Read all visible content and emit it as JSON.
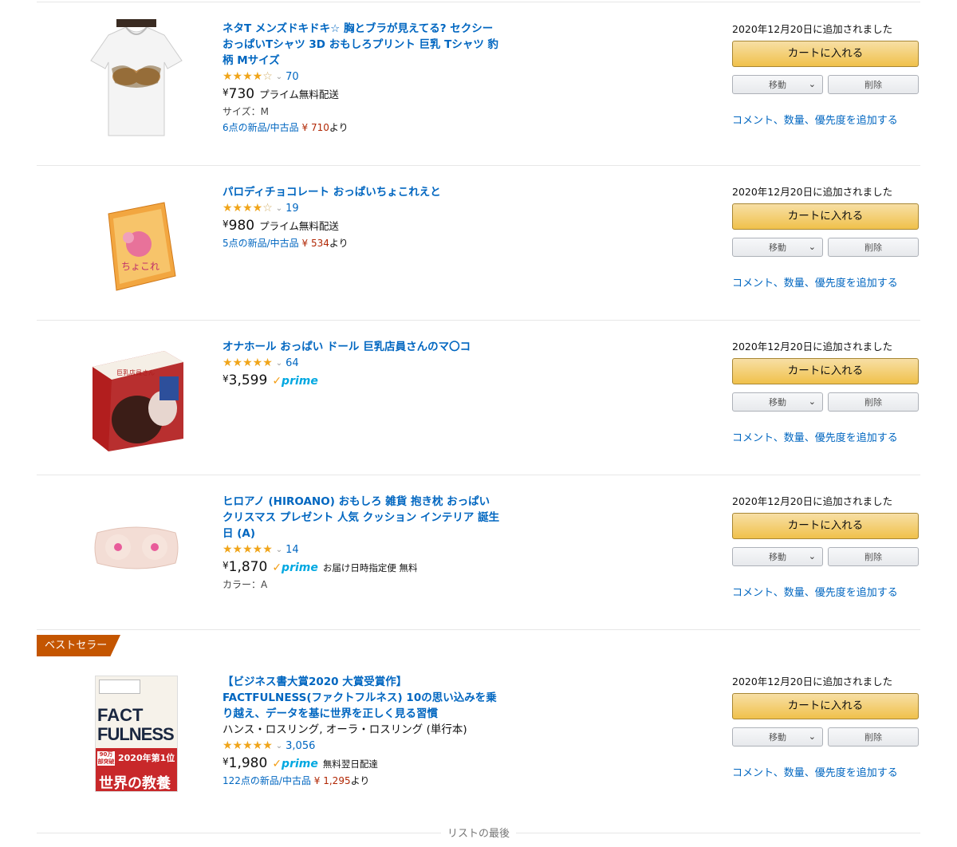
{
  "colors": {
    "link": "#0066c0",
    "price_red": "#b12704",
    "cart_button": "#f0c14b",
    "badge": "#c45500",
    "prime": "#00a8e1",
    "star": "#f0a51a"
  },
  "items": [
    {
      "title": "ネタT メンズドキドキ☆ 胸とブラが見えてる? セクシーおっぱいTシャツ 3D おもしろプリント 巨乳 Tシャツ 豹柄 Mサイズ",
      "rating": 3.5,
      "stars": "★★★★",
      "stars_empty": "☆",
      "review_count": "70",
      "price": "730",
      "currency": "¥",
      "shipping": "プライム無料配送",
      "variant": "サイズ：M",
      "offers_text": "6点の新品/中古品",
      "offers_price": "¥ 710",
      "offers_suffix": "より",
      "date_added": "2020年12月20日に追加されました",
      "image_icon": "tshirt-image"
    },
    {
      "title": "パロディチョコレート おっぱいちょこれえと",
      "rating": 3.5,
      "stars": "★★★★",
      "stars_empty": "☆",
      "review_count": "19",
      "price": "980",
      "currency": "¥",
      "shipping": "プライム無料配送",
      "offers_text": "5点の新品/中古品",
      "offers_price": "¥ 534",
      "offers_suffix": "より",
      "date_added": "2020年12月20日に追加されました",
      "image_icon": "chocolate-bag-image"
    },
    {
      "title": "オナホール おっぱい ドール 巨乳店員さんのマ〇コ",
      "rating": 4.5,
      "stars": "★★★★★",
      "review_count": "64",
      "price": "3,599",
      "currency": "¥",
      "prime_label": "prime",
      "date_added": "2020年12月20日に追加されました",
      "image_icon": "product-box-image"
    },
    {
      "title": "ヒロアノ (HIROANO) おもしろ 雑貨 抱き枕 おっぱい クリスマス プレゼント 人気 クッション インテリア 誕生日 (A)",
      "rating": 4.5,
      "stars": "★★★★★",
      "review_count": "14",
      "price": "1,870",
      "currency": "¥",
      "prime_label": "prime",
      "shipping": "お届け日時指定便 無料",
      "variant": "カラー：A",
      "date_added": "2020年12月20日に追加されました",
      "image_icon": "cushion-image"
    },
    {
      "badge": "ベストセラー",
      "title": "【ビジネス書大賞2020 大賞受賞作】FACTFULNESS(ファクトフルネス) 10の思い込みを乗り越え、データを基に世界を正しく見る習慣",
      "author": "ハンス・ロスリング, オーラ・ロスリング (単行本)",
      "rating": 4.5,
      "stars": "★★★★★",
      "review_count": "3,056",
      "price": "1,980",
      "currency": "¥",
      "prime_label": "prime",
      "shipping": "無料翌日配達",
      "offers_text": "122点の新品/中古品",
      "offers_price": "¥ 1,295",
      "offers_suffix": "より",
      "date_added": "2020年12月20日に追加されました",
      "image_icon": "book-cover-image",
      "book": {
        "line1": "FACT",
        "line2": "FULNESS",
        "sub1": "90万部突破",
        "sub2": "2020年第1位",
        "sub3": "世界の教養"
      }
    }
  ],
  "buttons": {
    "add_to_cart": "カートに入れる",
    "move": "移動",
    "delete": "削除",
    "comment": "コメント、数量、優先度を追加する"
  },
  "list_end": "リストの最後"
}
